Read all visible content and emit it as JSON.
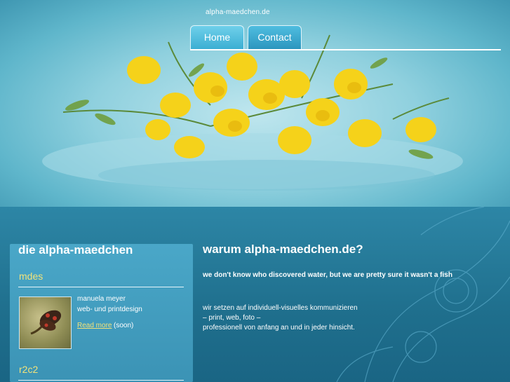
{
  "site": {
    "url_text": "alpha-maedchen.de"
  },
  "nav": {
    "tabs": [
      {
        "label": "Home",
        "active": true
      },
      {
        "label": "Contact",
        "active": false
      }
    ]
  },
  "sidebar": {
    "title": "die alpha-maedchen",
    "sections": [
      {
        "heading": "mdes",
        "person_name": "manuela meyer",
        "person_role": "web- und printdesign",
        "read_more": "Read more",
        "read_more_note": "(soon)"
      },
      {
        "heading": "r2c2"
      }
    ]
  },
  "main": {
    "title": "warum alpha-maedchen.de?",
    "tagline": "we don't know who discovered water, but we are pretty sure it wasn't a fish",
    "body_lines": [
      "wir setzen auf individuell-visuelles kommunizieren",
      "– print, web, foto –",
      "professionell von anfang an und in jeder hinsicht."
    ]
  },
  "colors": {
    "accent_yellow": "#f1e27a",
    "background_blue": "#1d6e8c",
    "tab_blue": "#3aaed2"
  }
}
